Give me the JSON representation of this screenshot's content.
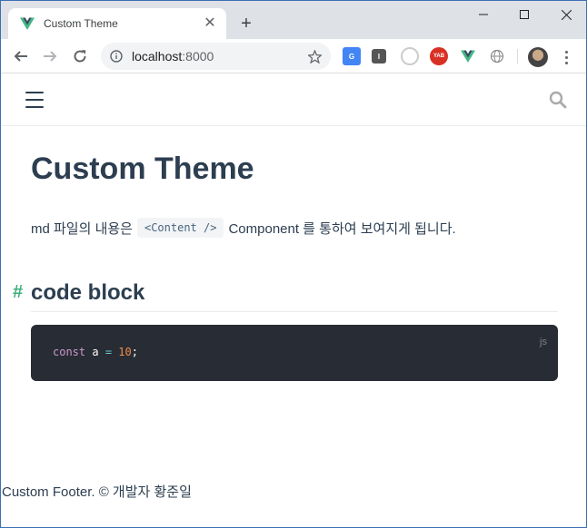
{
  "browser": {
    "tab": {
      "title": "Custom Theme",
      "favicon": "vue-logo-icon"
    },
    "url": {
      "host": "localhost",
      "port": ":8000"
    }
  },
  "page": {
    "title": "Custom Theme",
    "intro": {
      "before": "md 파일의 내용은",
      "code": "<Content />",
      "after": "Component 를 통하여 보여지게 됩니다."
    },
    "section": {
      "anchor": "#",
      "heading": "code block",
      "code": {
        "lang": "js",
        "kw": "const",
        "ident": " a ",
        "op": "=",
        "space": " ",
        "num": "10",
        "end": ";"
      }
    },
    "footer": "Custom Footer. © 개발자 황준일"
  },
  "colors": {
    "accent": "#3eaf7c",
    "text": "#2c3e50",
    "code_bg": "#282c34"
  }
}
